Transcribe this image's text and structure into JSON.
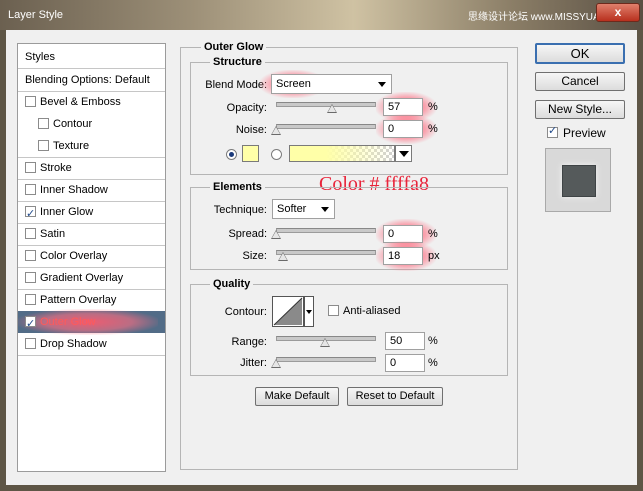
{
  "window": {
    "title": "Layer Style",
    "watermark": "思缘设计论坛 www.MISSYUAN.COM",
    "close_label": "x"
  },
  "sidebar": {
    "styles_label": "Styles",
    "blending_label": "Blending Options: Default",
    "items": [
      {
        "label": "Bevel & Emboss",
        "checked": false
      },
      {
        "label": "Contour",
        "checked": false
      },
      {
        "label": "Texture",
        "checked": false
      },
      {
        "label": "Stroke",
        "checked": false
      },
      {
        "label": "Inner Shadow",
        "checked": false
      },
      {
        "label": "Inner Glow",
        "checked": true
      },
      {
        "label": "Satin",
        "checked": false
      },
      {
        "label": "Color Overlay",
        "checked": false
      },
      {
        "label": "Gradient Overlay",
        "checked": false
      },
      {
        "label": "Pattern Overlay",
        "checked": false
      },
      {
        "label": "Outer Glow",
        "checked": true,
        "selected": true
      },
      {
        "label": "Drop Shadow",
        "checked": false
      }
    ]
  },
  "outer_glow": {
    "title": "Outer Glow",
    "structure": {
      "title": "Structure",
      "blend_mode_label": "Blend Mode:",
      "blend_mode_value": "Screen",
      "opacity_label": "Opacity:",
      "opacity_value": "57",
      "opacity_level": 57,
      "noise_label": "Noise:",
      "noise_value": "0",
      "noise_level": 0,
      "percent": "%",
      "color": "#ffffa8",
      "color_mode": "solid"
    },
    "elements": {
      "title": "Elements",
      "technique_label": "Technique:",
      "technique_value": "Softer",
      "spread_label": "Spread:",
      "spread_value": "0",
      "spread_level": 0,
      "size_label": "Size:",
      "size_value": "18",
      "size_level": 7,
      "percent": "%",
      "px": "px"
    },
    "quality": {
      "title": "Quality",
      "contour_label": "Contour:",
      "anti_aliased_label": "Anti-aliased",
      "anti_aliased": false,
      "range_label": "Range:",
      "range_value": "50",
      "range_level": 50,
      "jitter_label": "Jitter:",
      "jitter_value": "0",
      "jitter_level": 0,
      "percent": "%"
    },
    "make_default_label": "Make Default",
    "reset_default_label": "Reset to Default"
  },
  "annotation": {
    "text": "Color # ffffa8"
  },
  "buttons": {
    "ok_label": "OK",
    "cancel_label": "Cancel",
    "new_style_label": "New Style...",
    "preview_label": "Preview",
    "preview_checked": true
  },
  "colors": {
    "highlight": "#ff5a6e",
    "selected_row": "#526c87",
    "preview_swatch": "#555a5b"
  }
}
